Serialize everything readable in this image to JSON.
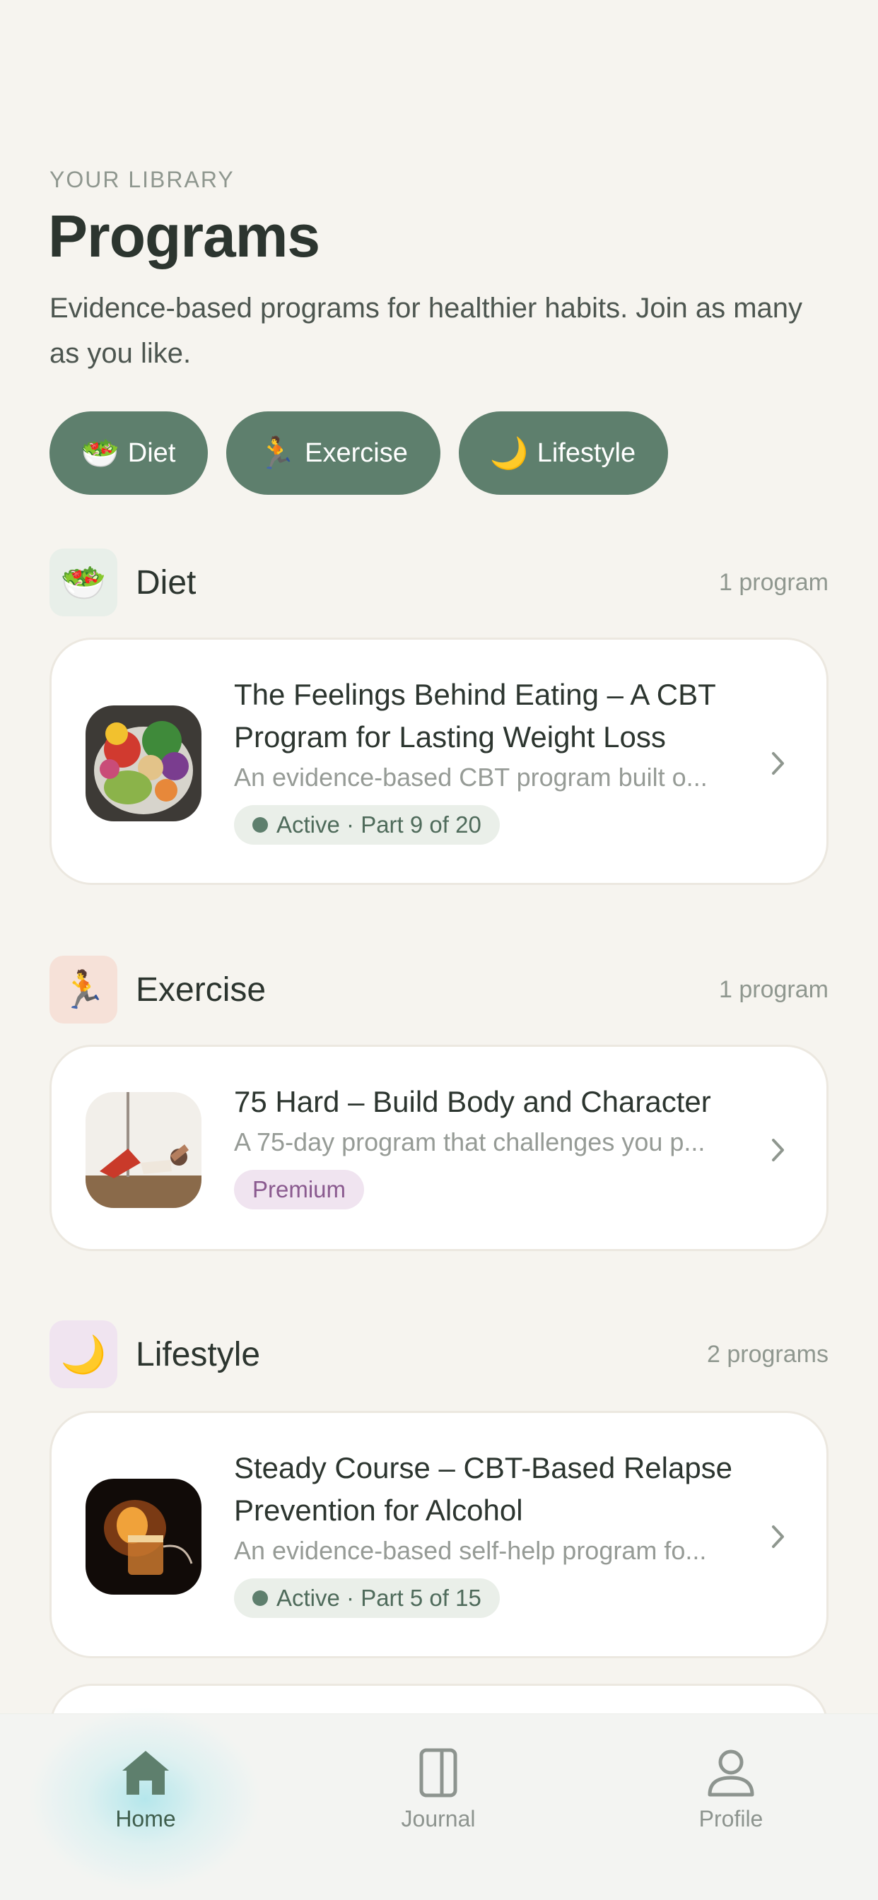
{
  "header": {
    "eyebrow": "YOUR LIBRARY",
    "title": "Programs",
    "subtitle": "Evidence-based programs for healthier habits. Join as many as you like."
  },
  "filters": [
    {
      "label": "Diet",
      "emoji": "🥗"
    },
    {
      "label": "Exercise",
      "emoji": "🏃"
    },
    {
      "label": "Lifestyle",
      "emoji": "🌙"
    }
  ],
  "sections": [
    {
      "name": "Diet",
      "emoji": "🥗",
      "count": "1 program",
      "icon_bg": "#e8efe9",
      "programs": [
        {
          "title": "The Feelings Behind Eating – A CBT Program for Lasting Weight Loss",
          "description": "An evidence-based CBT program built o...",
          "badge": "Active · Part 9 of 20",
          "badge_type": "active"
        }
      ]
    },
    {
      "name": "Exercise",
      "emoji": "🏃",
      "count": "1 program",
      "icon_bg": "#f6e1d8",
      "programs": [
        {
          "title": "75 Hard – Build Body and Character",
          "description": "A 75-day program that challenges you p...",
          "badge": "Premium",
          "badge_type": "premium"
        }
      ]
    },
    {
      "name": "Lifestyle",
      "emoji": "🌙",
      "count": "2 programs",
      "icon_bg": "#f0e4f0",
      "programs": [
        {
          "title": "Steady Course – CBT-Based Relapse Prevention for Alcohol",
          "description": "An evidence-based self-help program fo...",
          "badge": "Active · Part 5 of 15",
          "badge_type": "active"
        }
      ]
    }
  ],
  "nav": {
    "items": [
      {
        "label": "Home",
        "icon": "home-icon",
        "active": true
      },
      {
        "label": "Journal",
        "icon": "journal-icon",
        "active": false
      },
      {
        "label": "Profile",
        "icon": "profile-icon",
        "active": false
      }
    ]
  },
  "colors": {
    "accent": "#5e7f6d",
    "background": "#f6f4ef",
    "premium": "#8a5a8f"
  }
}
